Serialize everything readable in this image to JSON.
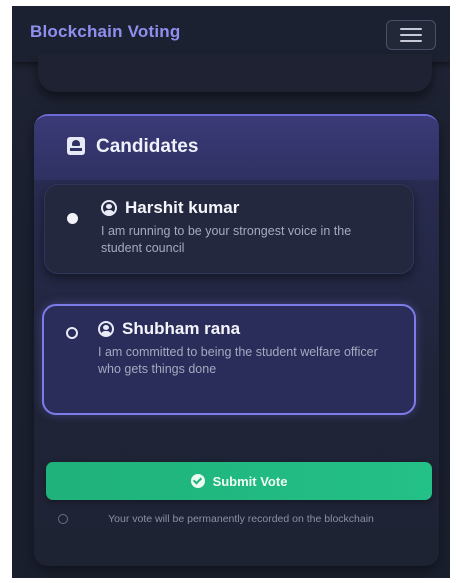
{
  "navbar": {
    "brand": "Blockchain Voting",
    "menu_icon": "hamburger-menu-icon"
  },
  "candidates_panel": {
    "title": "Candidates",
    "title_icon": "id-card-icon",
    "candidates": [
      {
        "name": "Harshit kumar",
        "description": "I am running to be your strongest voice in the student council",
        "selected": false,
        "icon": "user-circle-icon"
      },
      {
        "name": "Shubham rana",
        "description": "I am committed to being the student welfare officer who gets things done",
        "selected": true,
        "icon": "user-circle-icon"
      }
    ]
  },
  "submit": {
    "label": "Submit Vote",
    "icon": "check-circle-icon"
  },
  "note": {
    "text": "Your vote will be permanently recorded on the blockchain",
    "icon": "info-icon"
  },
  "colors": {
    "brand": "#8f8ff0",
    "accent_border": "#7d7be8",
    "submit_green": "#1fb27a",
    "background": "#1b2030"
  }
}
